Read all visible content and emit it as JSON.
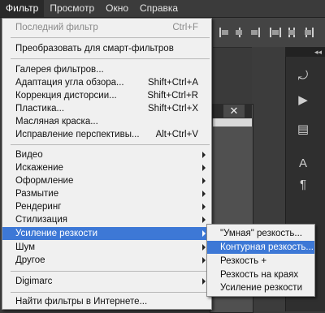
{
  "menubar": {
    "items": [
      {
        "label": "Фильтр"
      },
      {
        "label": "Просмотр"
      },
      {
        "label": "Окно"
      },
      {
        "label": "Справка"
      }
    ]
  },
  "filter_menu": {
    "last_filter": {
      "label": "Последний фильтр",
      "shortcut": "Ctrl+F"
    },
    "smart_filters": {
      "label": "Преобразовать для смарт-фильтров"
    },
    "gallery": {
      "label": "Галерея фильтров..."
    },
    "adaptive_wide": {
      "label": "Адаптация угла обзора...",
      "shortcut": "Shift+Ctrl+A"
    },
    "lens_correction": {
      "label": "Коррекция дисторсии...",
      "shortcut": "Shift+Ctrl+R"
    },
    "liquify": {
      "label": "Пластика...",
      "shortcut": "Shift+Ctrl+X"
    },
    "oil_paint": {
      "label": "Масляная краска..."
    },
    "vanishing_point": {
      "label": "Исправление перспективы...",
      "shortcut": "Alt+Ctrl+V"
    },
    "video": {
      "label": "Видео"
    },
    "distort": {
      "label": "Искажение"
    },
    "render_style": {
      "label": "Оформление"
    },
    "blur": {
      "label": "Размытие"
    },
    "render": {
      "label": "Рендеринг"
    },
    "stylize": {
      "label": "Стилизация"
    },
    "sharpen": {
      "label": "Усиление резкости"
    },
    "noise": {
      "label": "Шум"
    },
    "other": {
      "label": "Другое"
    },
    "digimarc": {
      "label": "Digimarc"
    },
    "browse_online": {
      "label": "Найти фильтры в Интернете..."
    }
  },
  "sharpen_submenu": {
    "items": [
      {
        "label": "\"Умная\" резкость..."
      },
      {
        "label": "Контурная резкость..."
      },
      {
        "label": "Резкость +"
      },
      {
        "label": "Резкость на краях"
      },
      {
        "label": "Усиление резкости"
      }
    ]
  },
  "panel": {
    "collapse_label": "◂◂",
    "close_glyph": "✕"
  },
  "colors": {
    "highlight": "#3d78d6",
    "menu_bg": "#f0f0f0",
    "workspace": "#3a3a3a"
  }
}
